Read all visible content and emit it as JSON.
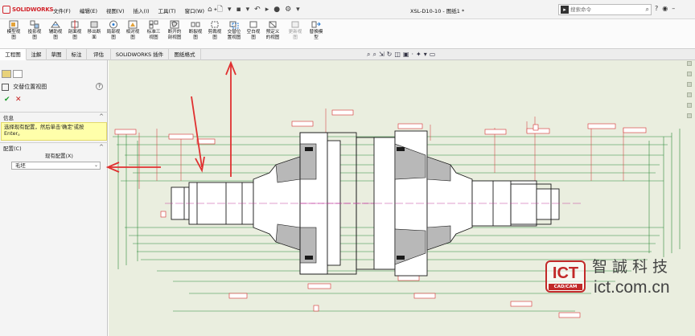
{
  "app": {
    "logo_text": "SOLIDWORKS",
    "document_title": "XSL-D10-10 - 图纸1 *"
  },
  "menu": [
    "文件(F)",
    "编辑(E)",
    "视图(V)",
    "插入(I)",
    "工具(T)",
    "窗口(W)"
  ],
  "search": {
    "placeholder": "搜索命令"
  },
  "ribbon": [
    {
      "label_1": "模型视",
      "label_2": "图",
      "icon": "model-view-icon"
    },
    {
      "label_1": "投影视",
      "label_2": "图",
      "icon": "projected-view-icon"
    },
    {
      "label_1": "辅助视",
      "label_2": "图",
      "icon": "auxiliary-view-icon"
    },
    {
      "label_1": "剖面视",
      "label_2": "图",
      "icon": "section-view-icon"
    },
    {
      "label_1": "移出断",
      "label_2": "面",
      "icon": "removed-section-icon"
    },
    {
      "label_1": "局部视",
      "label_2": "图",
      "icon": "detail-view-icon"
    },
    {
      "label_1": "相对视",
      "label_2": "图",
      "icon": "relative-view-icon"
    },
    {
      "label_1": "标准三",
      "label_2": "视图",
      "icon": "standard-3-view-icon"
    },
    {
      "label_1": "断开的",
      "label_2": "剖视图",
      "icon": "broken-out-section-icon"
    },
    {
      "label_1": "断裂视",
      "label_2": "图",
      "icon": "break-view-icon"
    },
    {
      "label_1": "剪裁视",
      "label_2": "图",
      "icon": "crop-view-icon"
    },
    {
      "label_1": "交替位",
      "label_2": "置视图",
      "icon": "alternate-position-view-icon"
    },
    {
      "label_1": "空白视",
      "label_2": "图",
      "icon": "empty-view-icon"
    },
    {
      "label_1": "预定义",
      "label_2": "的视图",
      "icon": "predefined-view-icon"
    },
    {
      "label_1": "更新视",
      "label_2": "图",
      "icon": "update-view-icon",
      "disabled": true
    },
    {
      "label_1": "替换模",
      "label_2": "型",
      "icon": "replace-model-icon"
    }
  ],
  "tabs": [
    "工程图",
    "注解",
    "草图",
    "标注",
    "评估",
    "SOLIDWORKS 插件",
    "图纸格式"
  ],
  "property_manager": {
    "title": "交替位置视图",
    "help": "?",
    "ok": "✔",
    "cancel": "✕",
    "sections": {
      "info": {
        "label": "信息",
        "text_1": "选择现有配置，然后单击'确定'或按",
        "text_2": "Enter。"
      },
      "config": {
        "label": "配置(C)",
        "existing_label": "现有配置(X)",
        "value": "毛坯"
      }
    }
  },
  "watermark": {
    "badge": "ICT",
    "badge_sub": "CAD/CAM",
    "chinese": "智誠科技",
    "url": "ict.com.cn"
  },
  "colors": {
    "drawing_bg": "#eaeedf",
    "geometry": "#1a1a1a",
    "dimension": "#d43030",
    "dimension_green": "#2d8a3a",
    "arrow": "#e03030"
  }
}
